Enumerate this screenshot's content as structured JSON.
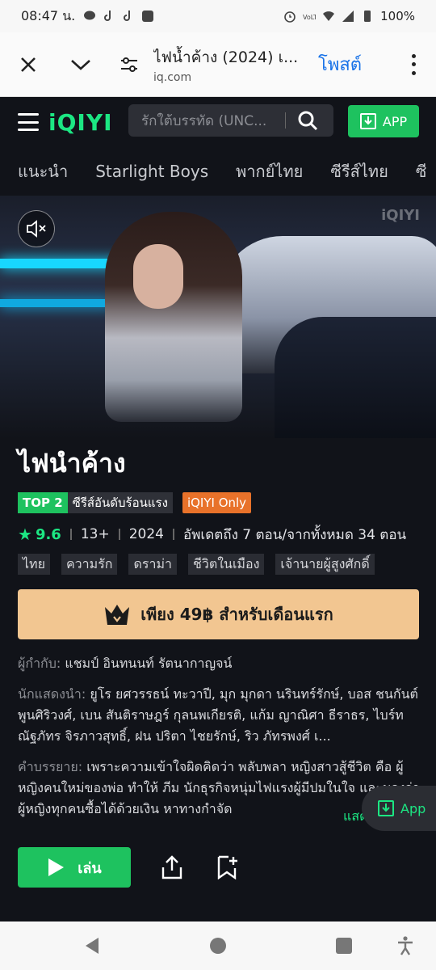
{
  "status_bar": {
    "time": "08:47 น.",
    "battery": "100%"
  },
  "browser": {
    "page_title": "ไฟน้ำค้าง (2024) เ...",
    "domain": "iq.com",
    "post_label": "โพสต์"
  },
  "header": {
    "logo": "iQIYI",
    "search_placeholder": "รักใต้บรรทัด (UNC...",
    "app_label": "APP"
  },
  "categories": [
    "แนะนำ",
    "Starlight Boys",
    "พากย์ไทย",
    "ซีรีส์ไทย",
    "ซี"
  ],
  "hero": {
    "watermark": "iQIYI"
  },
  "show": {
    "title": "ไฟนำค้าง",
    "rank_top": "TOP 2",
    "rank_label": "ซีรีส์อันดับร้อนแรง",
    "only_badge": "iQIYI Only",
    "score": "9.6",
    "age_rating": "13+",
    "year": "2024",
    "episodes": "อัพเดตถึง 7 ตอน/จากทั้งหมด 34 ตอน",
    "tags": [
      "ไทย",
      "ความรัก",
      "ดราม่า",
      "ชีวิตในเมือง",
      "เจ้านายผู้สูงศักดิ์"
    ],
    "vip_text": "เพียง 49฿ สำหรับเดือนแรก",
    "director_label": "ผู้กำกับ:",
    "director": "แชมป์ อินทนนท์ รัตนากาญจน์",
    "cast_label": "นักแสดงนำ:",
    "cast": "ยูโร ยศวรรธน์ ทะวาปี, มุก มุกดา นรินทร์รักษ์, บอส ชนกันต์ พูนศิริวงศ์, เบน สันติราษฎร์ กุลนพเกียรติ, แก้ม ญาณิศา ธีราธร, ไบร์ท ณัฐภัทร จิรภาวสุทธิ์, ฝน ปริตา ไชยรักษ์, ริว ภัทรพงศ์ เ...",
    "desc_label": "คำบรรยาย:",
    "desc": "เพราะความเข้าใจผิดคิดว่า พลับพลา หญิงสาวสู้ชีวิต คือ ผู้หญิงคนใหม่ของพ่อ ทำให้ ภีม นักธุรกิจหนุ่มไฟแรงผู้มีปมในใจ และมองว่าผู้หญิงทุกคนซื้อได้ด้วยเงิน หาทางกำจัด",
    "more_link": "แสดง",
    "float_app": "App",
    "play_label": "เล่น"
  }
}
